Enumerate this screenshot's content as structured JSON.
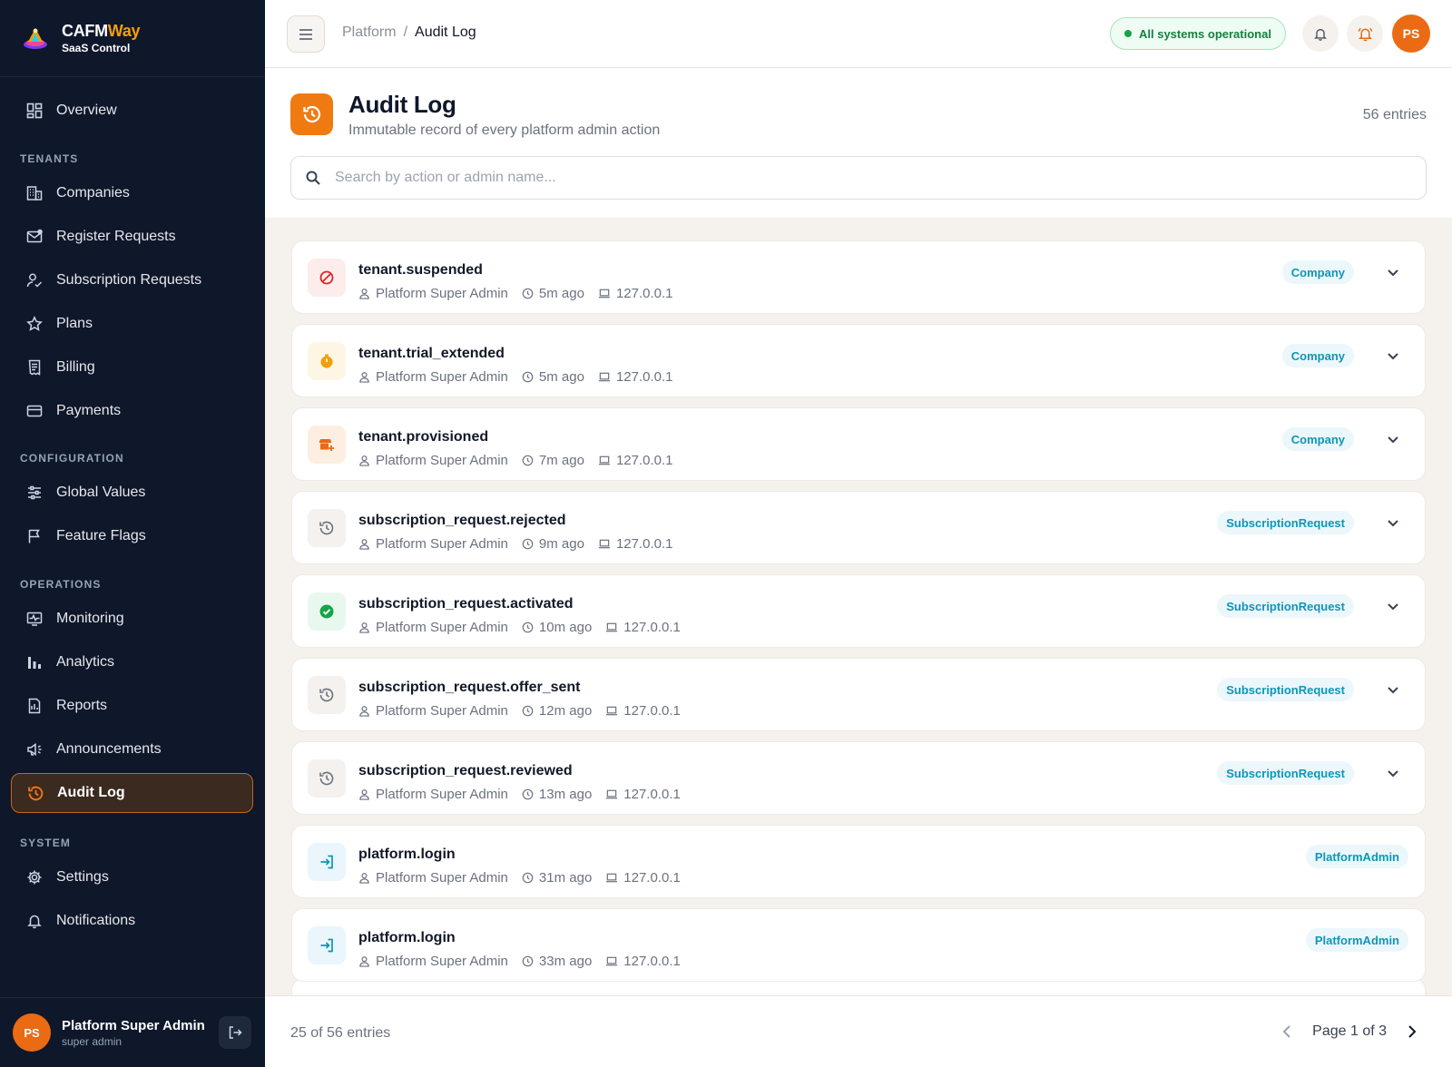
{
  "brand": {
    "name_main": "CAFM",
    "name_accent": "Way",
    "subtitle": "SaaS Control"
  },
  "sidebar": {
    "overview": "Overview",
    "sections": {
      "tenants": "TENANTS",
      "configuration": "CONFIGURATION",
      "operations": "OPERATIONS",
      "system": "SYSTEM"
    },
    "items": {
      "companies": "Companies",
      "register_requests": "Register Requests",
      "subscription_requests": "Subscription Requests",
      "plans": "Plans",
      "billing": "Billing",
      "payments": "Payments",
      "global_values": "Global Values",
      "feature_flags": "Feature Flags",
      "monitoring": "Monitoring",
      "analytics": "Analytics",
      "reports": "Reports",
      "announcements": "Announcements",
      "audit_log": "Audit Log",
      "settings": "Settings",
      "notifications": "Notifications"
    },
    "active": "audit_log",
    "user": {
      "initials": "PS",
      "name": "Platform Super Admin",
      "role": "super admin"
    }
  },
  "topbar": {
    "breadcrumb_parent": "Platform",
    "breadcrumb_sep": "/",
    "breadcrumb_current": "Audit Log",
    "status": "All systems operational",
    "avatar_initials": "PS"
  },
  "page": {
    "title": "Audit Log",
    "subtitle": "Immutable record of every platform admin action",
    "entries": "56 entries",
    "search_placeholder": "Search by action or admin name..."
  },
  "entries": [
    {
      "action": "tenant.suspended",
      "admin": "Platform Super Admin",
      "time": "5m ago",
      "ip": "127.0.0.1",
      "entity": "Company",
      "icon": "ban-icon",
      "tone": "red",
      "expandable": true
    },
    {
      "action": "tenant.trial_extended",
      "admin": "Platform Super Admin",
      "time": "5m ago",
      "ip": "127.0.0.1",
      "entity": "Company",
      "icon": "timer-icon",
      "tone": "amber",
      "expandable": true
    },
    {
      "action": "tenant.provisioned",
      "admin": "Platform Super Admin",
      "time": "7m ago",
      "ip": "127.0.0.1",
      "entity": "Company",
      "icon": "store-add-icon",
      "tone": "orange",
      "expandable": true
    },
    {
      "action": "subscription_request.rejected",
      "admin": "Platform Super Admin",
      "time": "9m ago",
      "ip": "127.0.0.1",
      "entity": "SubscriptionRequest",
      "icon": "history-icon",
      "tone": "gray",
      "expandable": true
    },
    {
      "action": "subscription_request.activated",
      "admin": "Platform Super Admin",
      "time": "10m ago",
      "ip": "127.0.0.1",
      "entity": "SubscriptionRequest",
      "icon": "check-circle-icon",
      "tone": "green",
      "expandable": true
    },
    {
      "action": "subscription_request.offer_sent",
      "admin": "Platform Super Admin",
      "time": "12m ago",
      "ip": "127.0.0.1",
      "entity": "SubscriptionRequest",
      "icon": "history-icon",
      "tone": "gray",
      "expandable": true
    },
    {
      "action": "subscription_request.reviewed",
      "admin": "Platform Super Admin",
      "time": "13m ago",
      "ip": "127.0.0.1",
      "entity": "SubscriptionRequest",
      "icon": "history-icon",
      "tone": "gray",
      "expandable": true
    },
    {
      "action": "platform.login",
      "admin": "Platform Super Admin",
      "time": "31m ago",
      "ip": "127.0.0.1",
      "entity": "PlatformAdmin",
      "icon": "login-icon",
      "tone": "blue",
      "expandable": false
    },
    {
      "action": "platform.login",
      "admin": "Platform Super Admin",
      "time": "33m ago",
      "ip": "127.0.0.1",
      "entity": "PlatformAdmin",
      "icon": "login-icon",
      "tone": "blue",
      "expandable": false
    }
  ],
  "footer": {
    "count": "25 of 56 entries",
    "page": "Page 1 of 3"
  },
  "colors": {
    "accent": "#f07a12",
    "sidebar_bg": "#0f172a",
    "badge_text": "#0e96b8",
    "status_green": "#15803d"
  }
}
